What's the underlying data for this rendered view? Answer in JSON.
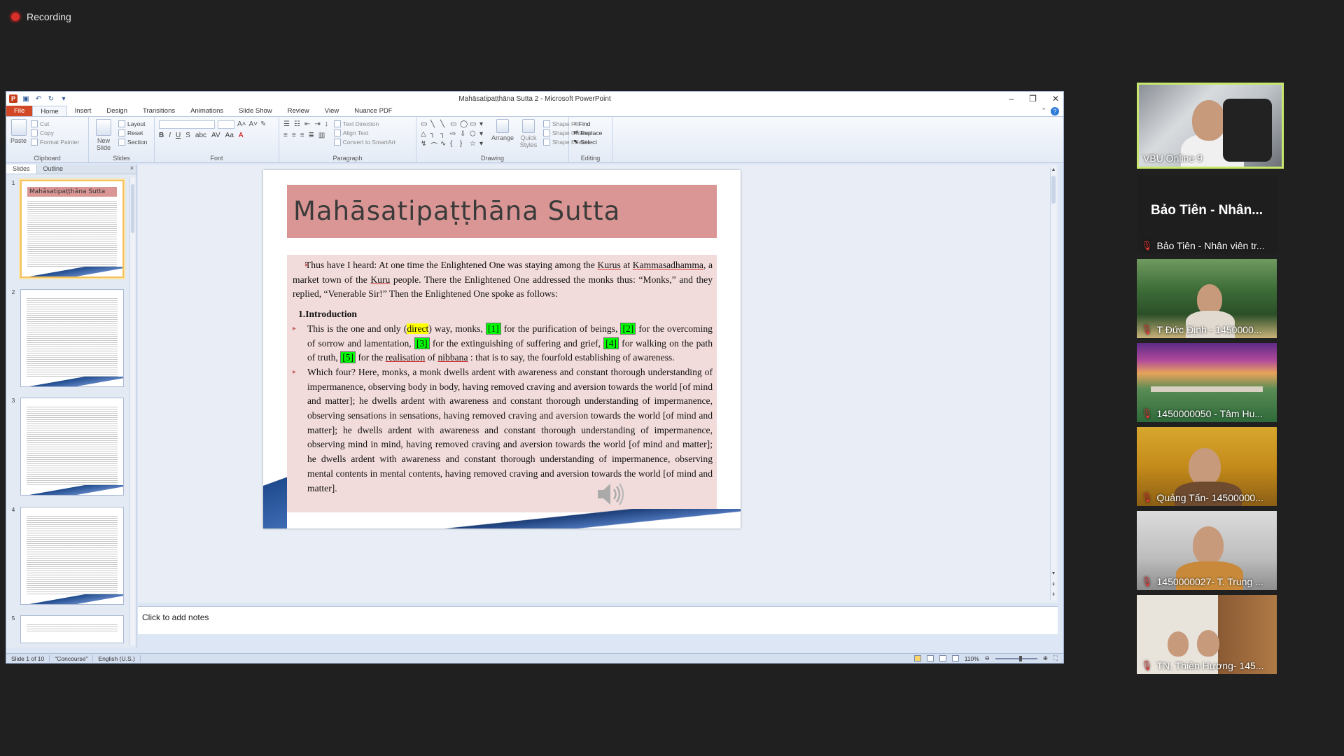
{
  "recording": {
    "label": "Recording"
  },
  "ppt": {
    "window_title": "Mahāsatipaṭṭhāna  Sutta 2  -  Microsoft PowerPoint",
    "tabs": [
      "File",
      "Home",
      "Insert",
      "Design",
      "Transitions",
      "Animations",
      "Slide Show",
      "Review",
      "View",
      "Nuance PDF"
    ],
    "active_tab": "Home",
    "ribbon": {
      "clipboard": {
        "label": "Clipboard",
        "paste": "Paste",
        "cut": "Cut",
        "copy": "Copy",
        "format_painter": "Format Painter"
      },
      "slides": {
        "label": "Slides",
        "new_slide": "New Slide",
        "layout": "Layout",
        "reset": "Reset",
        "section": "Section"
      },
      "font": {
        "label": "Font",
        "bold": "B",
        "italic": "I",
        "underline": "U",
        "strike": "S",
        "abc": "abc",
        "av": "AV",
        "aa": "Aa",
        "color": "A"
      },
      "paragraph": {
        "label": "Paragraph",
        "text_direction": "Text Direction",
        "align_text": "Align Text",
        "convert_smartart": "Convert to SmartArt"
      },
      "drawing": {
        "label": "Drawing",
        "arrange": "Arrange",
        "quick_styles": "Quick Styles",
        "shape_fill": "Shape Fill",
        "shape_outline": "Shape Outline",
        "shape_effects": "Shape Effects"
      },
      "editing": {
        "label": "Editing",
        "find": "Find",
        "replace": "Replace",
        "select": "Select"
      }
    },
    "panel": {
      "tabs": [
        "Slides",
        "Outline"
      ],
      "close": "×",
      "thumbnails": [
        {
          "num": "1",
          "title": "Mahāsatipaṭṭhāna  Sutta",
          "selected": true
        },
        {
          "num": "2",
          "title": "",
          "selected": false
        },
        {
          "num": "3",
          "title": "",
          "selected": false
        },
        {
          "num": "4",
          "title": "",
          "selected": false
        },
        {
          "num": "5",
          "title": "",
          "selected": false
        }
      ]
    },
    "slide": {
      "title": "Mahāsatipaṭṭhāna  Sutta",
      "para1_a": "Thus have I heard: At one time the Enlightened One was staying among the ",
      "para1_kurus": "Kurus",
      "para1_b": " at ",
      "para1_kamma": "Kammasadhamma",
      "para1_c": ", a market town of the ",
      "para1_kuru": "Kuru",
      "para1_d": " people. There the Enlightened One addressed the monks thus: “Monks,” and they replied, “Venerable Sir!” Then the Enlightened One spoke as follows:",
      "heading": "1.Introduction",
      "para2_a": "This is the one and only (",
      "para2_direct": "direct",
      "para2_b": ") way, monks, ",
      "ref1": "[1]",
      "para2_c": " for the purification of beings, ",
      "ref2": "[2]",
      "para2_d": " for the overcoming of sorrow and lamentation, ",
      "ref3": "[3]",
      "para2_e": " for the extinguishing of suffering and grief, ",
      "ref4": "[4]",
      "para2_f": " for walking on the path of truth, ",
      "ref5": "[5]",
      "para2_g": " for the ",
      "para2_real": "realisation",
      "para2_h": " of ",
      "para2_nib": "nibbana",
      "para2_i": " : that is to say, the fourfold establishing of awareness.",
      "para3": "Which four? Here, monks, a monk dwells ardent with awareness and constant thorough understanding of impermanence, observing body in body, having removed craving and aversion towards the world [of mind and matter]; he dwells ardent with awareness and constant thorough understanding of impermanence, observing sensations in sensations, having removed craving and aversion towards the world [of mind and matter]; he dwells ardent with awareness and constant thorough understanding of impermanence, observing mind in mind, having removed craving and aversion towards the world [of mind and matter]; he dwells ardent with awareness and constant thorough understanding of impermanence, observing mental contents in mental contents, having removed craving and aversion towards the world [of mind and matter]."
    },
    "notes_placeholder": "Click to add notes",
    "status": {
      "slide": "Slide 1 of 10",
      "theme": "\"Concourse\"",
      "language": "English (U.S.)",
      "zoom": "110%"
    }
  },
  "participants": [
    {
      "name": "VBU Online 9",
      "active": true,
      "muted": false
    },
    {
      "name": "Bảo Tiên - Nhân viên tr...",
      "big_label": "Bảo Tiên - Nhân...",
      "muted": true
    },
    {
      "name": "T Đức Định - 1450000...",
      "muted": true
    },
    {
      "name": "1450000050 - Tâm Hu...",
      "muted": true
    },
    {
      "name": "Quảng Tấn- 14500000...",
      "muted": true
    },
    {
      "name": "1450000027- T. Trung ...",
      "muted": true
    },
    {
      "name": "TN. Thiên Hương- 145...",
      "muted": true
    }
  ],
  "icons": [
    "record-dot-icon",
    "save-icon",
    "undo-icon",
    "redo-icon",
    "minimize-icon",
    "restore-icon",
    "close-icon",
    "help-icon",
    "speaker-icon",
    "mic-muted-icon"
  ]
}
